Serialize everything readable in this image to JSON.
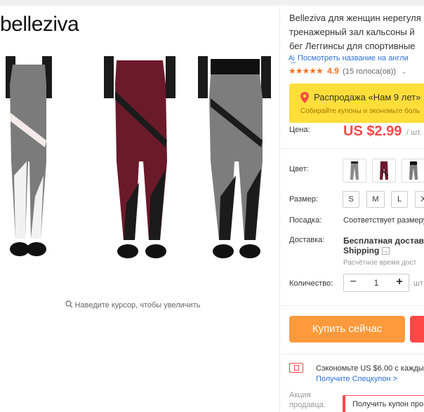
{
  "brand": {
    "logo_text": "belleziva"
  },
  "gallery": {
    "zoom_hint": "Наведите курсор, чтобы увеличить",
    "swatch_colors": [
      "#8a8a8a",
      "#6b1a2a",
      "#7d7d7d"
    ]
  },
  "product": {
    "title_lines": [
      "Belleziva для женщин нерегуля",
      "тренажерный зал кальсоны й",
      "бег Леггинсы для спортивные"
    ],
    "translate_link": "Посмотреть название на англи",
    "rating_value": "4.9",
    "votes": "(15 голоса(ов))"
  },
  "promo": {
    "title": "Распродажа «Нам 9 лет»",
    "subtitle": "Собирайте купоны и экономьте боль"
  },
  "price": {
    "label": "Цена:",
    "value": "US $2.99",
    "unit": "/ шт."
  },
  "options": {
    "color_label": "Цвет:",
    "size_label": "Размер:",
    "sizes": [
      "S",
      "M",
      "L",
      "X"
    ],
    "fit_label": "Посадка:",
    "fit_value": "Соответствует размеру"
  },
  "shipping": {
    "label": "Доставка:",
    "value": "Бесплатная доставка",
    "sub": "Shipping",
    "time": "Расчётное время дост"
  },
  "quantity": {
    "label": "Количество:",
    "minus": "−",
    "value": "1",
    "plus": "+",
    "note": "шт"
  },
  "actions": {
    "buy_now": "Купить сейчас"
  },
  "coupon": {
    "text": "Сэкономьте US $6.00 с кажды",
    "link": "Получите Спецкупон >"
  },
  "seller": {
    "label_line1": "Акция",
    "label_line2": "продавца:",
    "button": "Получить купон про"
  },
  "colors": {
    "accent": "#ff4747",
    "buy_button": "#ff9a3c",
    "promo_bg": "#ffde3a",
    "link": "#2a6fd6",
    "star": "#f57224"
  }
}
